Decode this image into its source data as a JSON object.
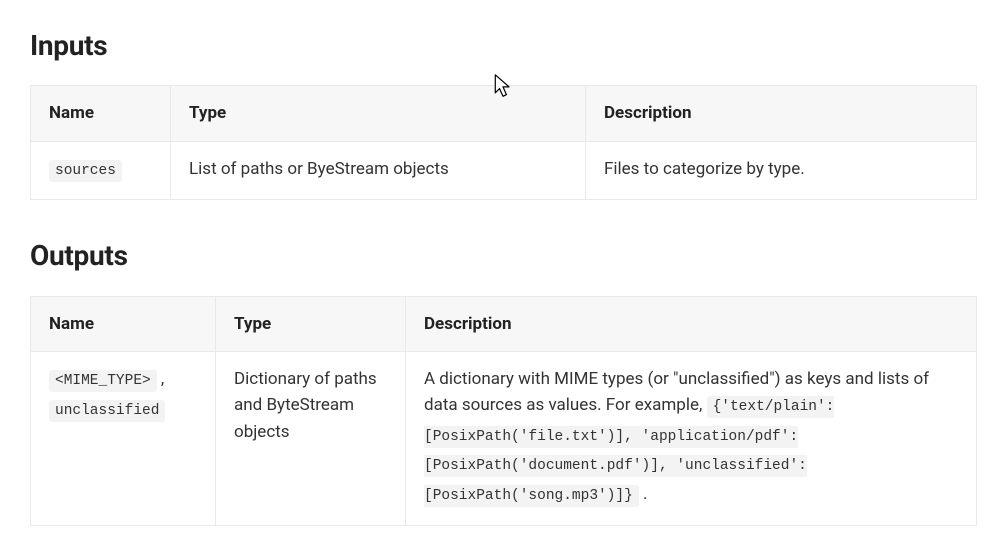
{
  "inputs": {
    "heading": "Inputs",
    "columns": {
      "name": "Name",
      "type": "Type",
      "description": "Description"
    },
    "rows": [
      {
        "name_code": "sources",
        "type": "List of paths or ByeStream objects",
        "description": "Files to categorize by type."
      }
    ]
  },
  "outputs": {
    "heading": "Outputs",
    "columns": {
      "name": "Name",
      "type": "Type",
      "description": "Description"
    },
    "rows": [
      {
        "name_code_1": "<MIME_TYPE>",
        "name_sep": " , ",
        "name_code_2": "unclassified",
        "type": "Dictionary of paths and ByteStream objects",
        "description_prefix": "A dictionary with MIME types (or \"unclassified\") as keys and lists of data sources as values. For example, ",
        "description_code": "{'text/plain': [PosixPath('file.txt')], 'application/pdf': [PosixPath('document.pdf')], 'unclassified': [PosixPath('song.mp3')]}",
        "description_suffix": " ."
      }
    ]
  }
}
